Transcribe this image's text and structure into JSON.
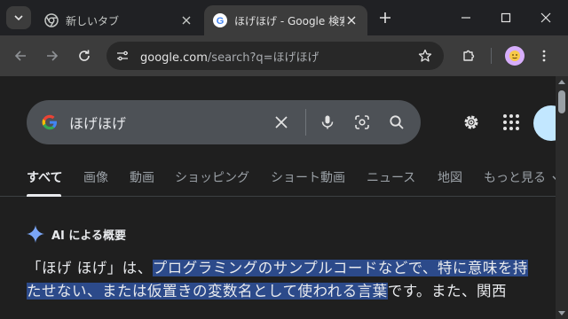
{
  "browser": {
    "tabs": [
      {
        "title": "新しいタブ",
        "active": false
      },
      {
        "title": "ほげほげ - Google 検索",
        "active": true
      }
    ],
    "url": {
      "host": "google.com",
      "path": "/search?q=ほげほげ"
    }
  },
  "search": {
    "query": "ほげほげ"
  },
  "nav_tabs": [
    "すべて",
    "画像",
    "動画",
    "ショッピング",
    "ショート動画",
    "ニュース",
    "地図",
    "もっと見る"
  ],
  "ai_overview": {
    "header": "AI による概要",
    "line1_plain": "「ほげ ほげ」は、",
    "line1_highlight": "プログラミングのサンプルコードなどで、特に意味を持",
    "line2_highlight": "たせない、または仮置きの変数名として使われる言葉",
    "line2_plain": "です。また、関西"
  },
  "colors": {
    "accent_highlight": "#2c4a8a",
    "signin": "#c2e7ff",
    "profile": "#d7aefb"
  }
}
